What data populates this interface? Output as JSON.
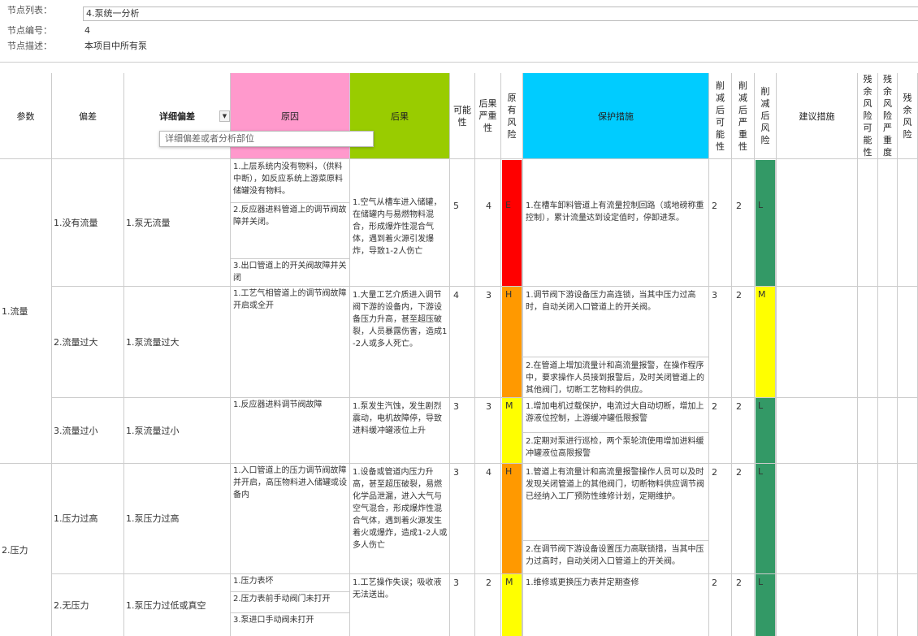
{
  "node": {
    "list_label": "节点列表：",
    "list_value": "4.泵统一分析",
    "id_label": "节点编号：",
    "id_value": "4",
    "desc_label": "节点描述：",
    "desc_value": "本项目中所有泵"
  },
  "headers": {
    "param": "参数",
    "deviation": "偏差",
    "detail_deviation": "详细偏差",
    "detail_placeholder": "详细偏差或者分析部位",
    "cause": "原因",
    "consequence": "后果",
    "possibility": "可能性",
    "consequence_severity": "后果严重性",
    "original_risk": "原有风险",
    "protection": "保护措施",
    "reduced_possibility": "削减后可能性",
    "reduced_severity": "削减后严重性",
    "reduced_risk": "削减后风险",
    "suggestion": "建议措施",
    "residual_possibility": "残余风险可能性",
    "residual_severity": "残余风险严重度",
    "residual_risk": "残余风险"
  },
  "colors": {
    "cause_header": "#FF99CC",
    "consequence_header": "#99CC00",
    "protection_header": "#00CCFF",
    "risk_E": "#FF0000",
    "risk_H": "#FF9900",
    "risk_M": "#FFFF00",
    "risk_L": "#339966"
  },
  "params": [
    {
      "label": "1.流量"
    },
    {
      "label": "2.压力"
    }
  ],
  "rows": [
    {
      "deviation": "1.没有流量",
      "detail": "1.泵无流量",
      "causes": [
        "1.上层系统内没有物料，（供料中断），如反应系统上游菜原料储罐没有物料。",
        "2.反应器进料管道上的调节阀故障并关闭。",
        "3.出口管道上的开关阀故障并关闭"
      ],
      "consequence": "1.空气从槽车进入储罐，在储罐内与易燃物料混合，形成爆炸性混合气体，遇到着火源引发爆炸，导致1-2人伤亡",
      "possibility": "5",
      "severity": "4",
      "risk": "E",
      "protections": [
        "1.在槽车卸料管道上有流量控制回路（或地磅称重控制），累计流量达到设定值时，停卸进泵。"
      ],
      "r_possibility": "2",
      "r_severity": "2",
      "r_risk": "L"
    },
    {
      "deviation": "2.流量过大",
      "detail": "1.泵流量过大",
      "causes": [
        "1.工艺气相管道上的调节阀故障开启或全开"
      ],
      "consequence": "1.大量工艺介质进入调节阀下游的设备内，下游设备压力升高，甚至超压破裂，人员暴露伤害，造成1-2人或多人死亡。",
      "possibility": "4",
      "severity": "3",
      "risk": "H",
      "protections": [
        "1.调节阀下游设备压力高连锁，当其中压力过高时，自动关闭入口管道上的开关阀。",
        "2.在管道上增加流量计和高流量报警，在操作程序中，要求操作人员接到报警后，及时关闭管道上的其他阀门，切断工艺物料的供应。"
      ],
      "r_possibility": "3",
      "r_severity": "2",
      "r_risk": "M"
    },
    {
      "deviation": "3.流量过小",
      "detail": "1.泵流量过小",
      "causes": [
        "1.反应器进料调节阀故障"
      ],
      "consequence": "1.泵发生汽蚀，发生剧烈震动，电机故障停，导致进料缓冲罐液位上升",
      "possibility": "3",
      "severity": "3",
      "risk": "M",
      "protections": [
        "1.增加电机过载保护，电流过大自动切断，增加上游液位控制，上游缓冲罐低限报警",
        "2.定期对泵进行巡检，两个泵轮流使用增加进料缓冲罐液位高限报警"
      ],
      "r_possibility": "2",
      "r_severity": "2",
      "r_risk": "L"
    },
    {
      "deviation": "1.压力过高",
      "detail": "1.泵压力过高",
      "causes": [
        "1.入口管道上的压力调节阀故障并开启，高压物料进入储罐或设备内"
      ],
      "consequence": "1.设备或管道内压力升高，甚至超压破裂，易燃化学品泄漏，进入大气与空气混合，形成爆炸性混合气体，遇到着火源发生着火或爆炸，造成1-2人或多人伤亡",
      "possibility": "3",
      "severity": "4",
      "risk": "H",
      "protections": [
        "1.管道上有流量计和高流量报警操作人员可以及时发现关闭管道上的其他阀门，切断物料供应调节阀已经纳入工厂预防性维修计划，定期维护。",
        "2.在调节阀下游设备设置压力高联锁措，当其中压力过高时，自动关闭入口管道上的开关阀。"
      ],
      "r_possibility": "2",
      "r_severity": "2",
      "r_risk": "L"
    },
    {
      "deviation": "2.无压力",
      "detail": "1.泵压力过低或真空",
      "causes": [
        "1.压力表坏",
        "2.压力表前手动阀门未打开",
        "3.泵进口手动阀未打开"
      ],
      "consequence": "1.工艺操作失误；吸收液无法送出。",
      "possibility": "3",
      "severity": "2",
      "risk": "M",
      "protections": [
        "1.维修或更换压力表并定期查修"
      ],
      "r_possibility": "2",
      "r_severity": "2",
      "r_risk": "L"
    }
  ]
}
